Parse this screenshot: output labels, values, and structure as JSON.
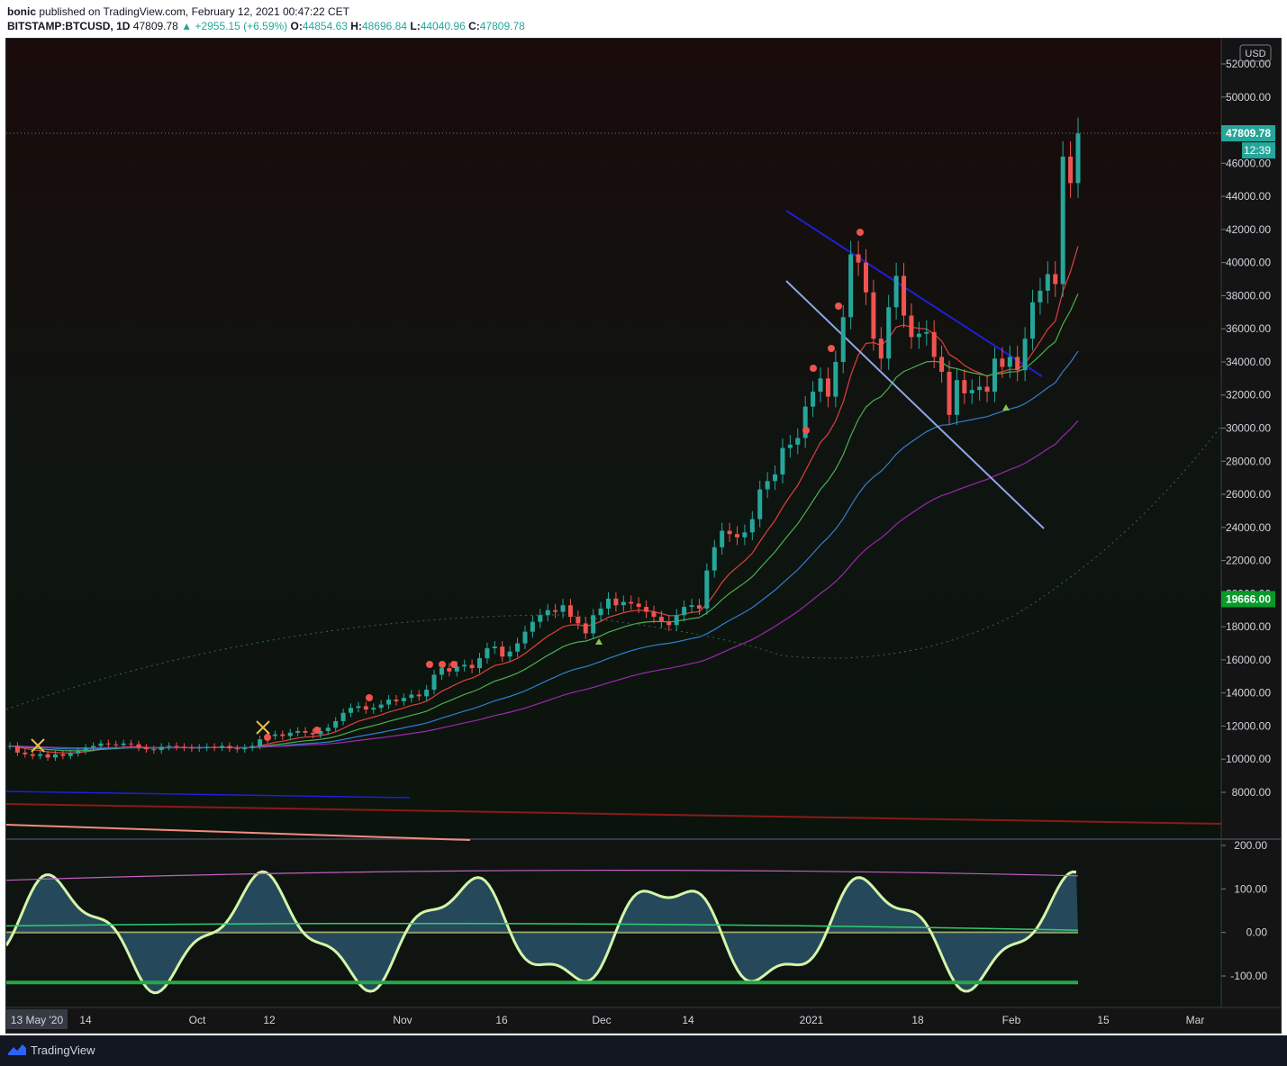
{
  "header": {
    "publisher": "bonic",
    "published_text": "published on TradingView.com, February 12, 2021 00:47:22 CET",
    "symbol": "BITSTAMP:BTCUSD, 1D",
    "last": "47809.78",
    "change": "+2955.15 (+6.59%)",
    "o_label": "O:",
    "o_value": "44854.63",
    "h_label": "H:",
    "h_value": "48696.84",
    "l_label": "L:",
    "l_value": "44040.96",
    "c_label": "C:",
    "c_value": "47809.78"
  },
  "price_axis": {
    "currency": "USD",
    "last_price_tag": "47809.78",
    "countdown_tag": "12:39",
    "level_tag": "19666.00"
  },
  "footer": {
    "brand": "TradingView"
  },
  "colors": {
    "up": "#26a69a",
    "down": "#ef5350",
    "background": "#141414",
    "upper_trend": "#1f1fd8",
    "lower_trend": "#8fa6e8",
    "ema1": "#e0403c",
    "ema2": "#4caf50",
    "ema3": "#2f7fd1",
    "ema4": "#9c27b0",
    "level_tag_bg": "#089a2a",
    "last_tag_bg": "#26a69a"
  },
  "chart_data": [
    {
      "type": "candlestick",
      "title": "BITSTAMP:BTCUSD, 1D",
      "ylim": [
        7000,
        53000
      ],
      "y_ticks": [
        "52000.00",
        "50000.00",
        "48000.00",
        "46000.00",
        "44000.00",
        "42000.00",
        "40000.00",
        "38000.00",
        "36000.00",
        "34000.00",
        "32000.00",
        "30000.00",
        "28000.00",
        "26000.00",
        "24000.00",
        "22000.00",
        "20000.00",
        "18000.00",
        "16000.00",
        "14000.00",
        "12000.00",
        "10000.00",
        "8000.00"
      ],
      "x_ticks": [
        "13 May '20",
        "14",
        "Oct",
        "12",
        "Nov",
        "16",
        "Dec",
        "14",
        "2021",
        "18",
        "Feb",
        "15",
        "Mar"
      ],
      "candles_note": "approximate daily closes read from the chart (start of visible range to Feb 11 2021)",
      "closes": [
        10800,
        10400,
        10300,
        10200,
        10300,
        10100,
        10300,
        10200,
        10350,
        10500,
        10700,
        10800,
        10950,
        10900,
        10850,
        10950,
        10900,
        10700,
        10600,
        10550,
        10750,
        10800,
        10750,
        10700,
        10650,
        10700,
        10750,
        10700,
        10800,
        10650,
        10600,
        10700,
        10800,
        11200,
        11400,
        11500,
        11400,
        11600,
        11700,
        11600,
        11500,
        11700,
        11900,
        12300,
        12800,
        13100,
        13200,
        13000,
        13100,
        13300,
        13600,
        13500,
        13700,
        13900,
        13800,
        14200,
        15100,
        15500,
        15300,
        15600,
        15700,
        15500,
        16100,
        16700,
        16800,
        16200,
        16500,
        17000,
        17700,
        18300,
        18700,
        19000,
        18900,
        19300,
        18600,
        18200,
        17600,
        18700,
        19100,
        19700,
        19300,
        19500,
        19400,
        19200,
        18900,
        18600,
        18300,
        18100,
        18700,
        19200,
        19300,
        19100,
        21400,
        22800,
        23800,
        23600,
        23400,
        23700,
        24500,
        26300,
        26800,
        27200,
        28800,
        29000,
        29400,
        31300,
        32200,
        33000,
        31900,
        34000,
        36700,
        40500,
        40000,
        38200,
        35400,
        34200,
        37300,
        39200,
        36800,
        35500,
        35700,
        35800,
        34300,
        33400,
        30800,
        32900,
        32100,
        32300,
        32500,
        32200,
        34200,
        33700,
        34300,
        33500,
        35400,
        37600,
        38300,
        39300,
        38700,
        46400,
        44800,
        47800
      ],
      "volume_profile_levels": [],
      "ema_note": "four moving averages below price",
      "annotations": []
    },
    {
      "type": "line",
      "title": "",
      "ylim": [
        -150,
        210
      ],
      "y_ticks": [
        "200.00",
        "100.00",
        "0.00",
        "-100.00"
      ]
    }
  ]
}
